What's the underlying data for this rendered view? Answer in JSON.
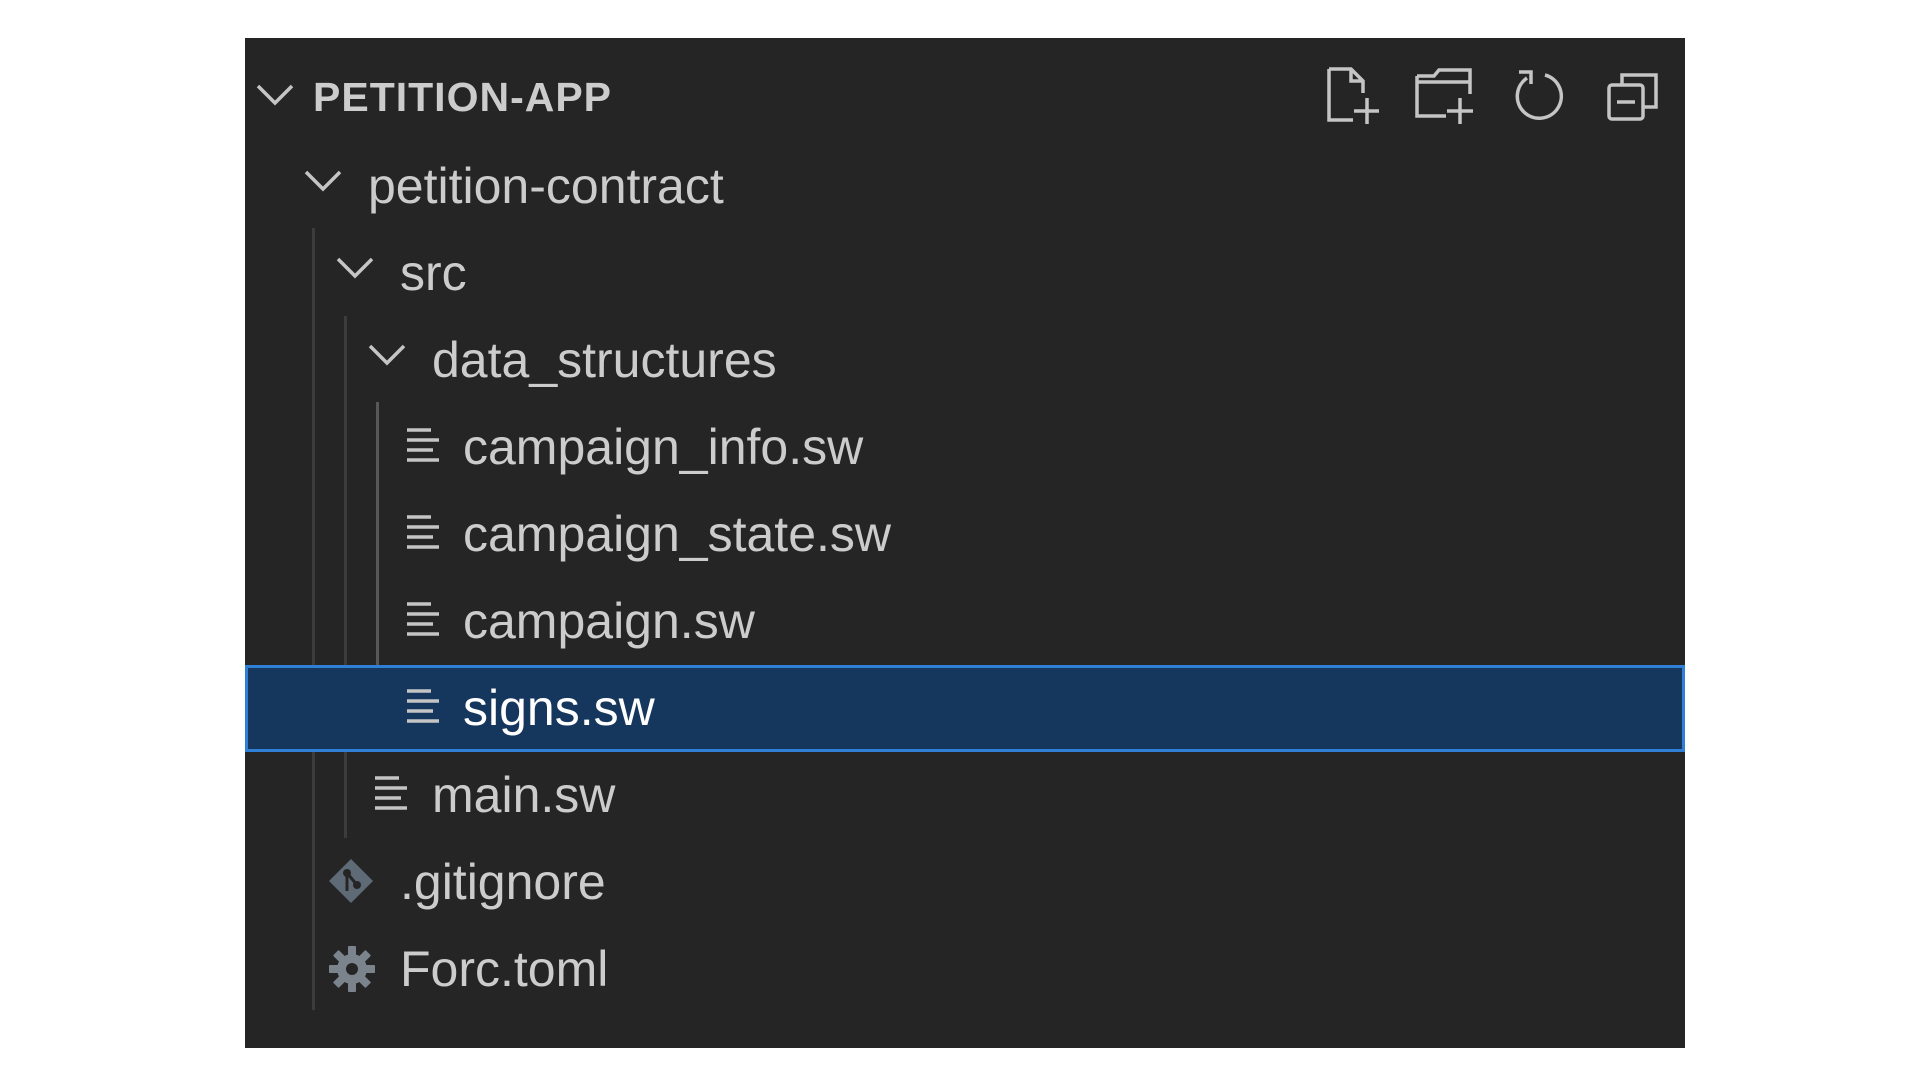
{
  "explorer": {
    "title": "PETITION-APP",
    "actions": [
      {
        "name": "new-file",
        "icon": "new-file-icon"
      },
      {
        "name": "new-folder",
        "icon": "new-folder-icon"
      },
      {
        "name": "refresh",
        "icon": "refresh-icon"
      },
      {
        "name": "collapse-all",
        "icon": "collapse-all-icon"
      }
    ],
    "tree": {
      "root_folder": "petition-contract",
      "src_folder": "src",
      "data_structures_folder": "data_structures",
      "files": {
        "campaign_info": "campaign_info.sw",
        "campaign_state": "campaign_state.sw",
        "campaign": "campaign.sw",
        "signs": "signs.sw",
        "main": "main.sw",
        "gitignore": ".gitignore",
        "forc": "Forc.toml"
      }
    },
    "selected": "signs.sw"
  },
  "colors": {
    "panel_bg": "#252526",
    "text": "#cccccc",
    "selection_bg": "#15375d",
    "selection_border": "#2f7fd6",
    "icon": "#c5c5c5"
  }
}
